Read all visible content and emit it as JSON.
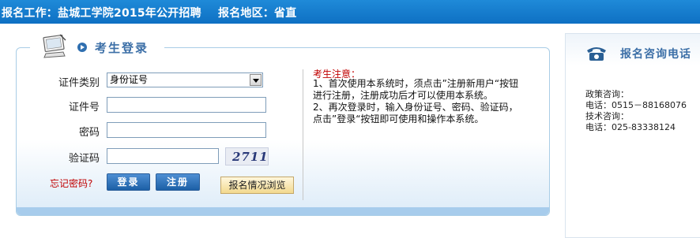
{
  "header": {
    "job_label": "报名工作：盐城工学院2015年公开招聘",
    "region_label": "报名地区：省直"
  },
  "login": {
    "title": "考生登录",
    "id_type_label": "证件类别",
    "id_type_selected": "身份证号",
    "id_number_label": "证件号",
    "id_number_value": "",
    "password_label": "密码",
    "password_value": "",
    "captcha_label": "验证码",
    "captcha_value": "",
    "captcha_image_text": "2711",
    "forgot_label": "忘记密码?",
    "login_button": "登录",
    "register_button": "注册",
    "browse_button": "报名情况浏览"
  },
  "notice": {
    "title": "考生注意：",
    "lines": [
      "1、首次使用本系统时，须点击”注册新用户“按钮",
      "进行注册，注册成功后才可以使用本系统。",
      "2、再次登录时，输入身份证号、密码、验证码，",
      "点击”登录“按钮即可使用和操作本系统。"
    ]
  },
  "contact": {
    "title": "报名咨询电话",
    "policy_label": "政策咨询：",
    "policy_phone": "电话：0515－88168076",
    "tech_label": "技术咨询：",
    "tech_phone": "电话：025-83338124"
  },
  "icons": {
    "monitor": "monitor-icon",
    "bullet": "arrow-bullet-icon",
    "dropdown": "chevron-down-icon",
    "phone": "telephone-icon"
  },
  "colors": {
    "header_bg": "#1478c8",
    "title_blue": "#3c6fa7",
    "notice_red": "#c00000",
    "button_blue": "#2f6fb8"
  }
}
